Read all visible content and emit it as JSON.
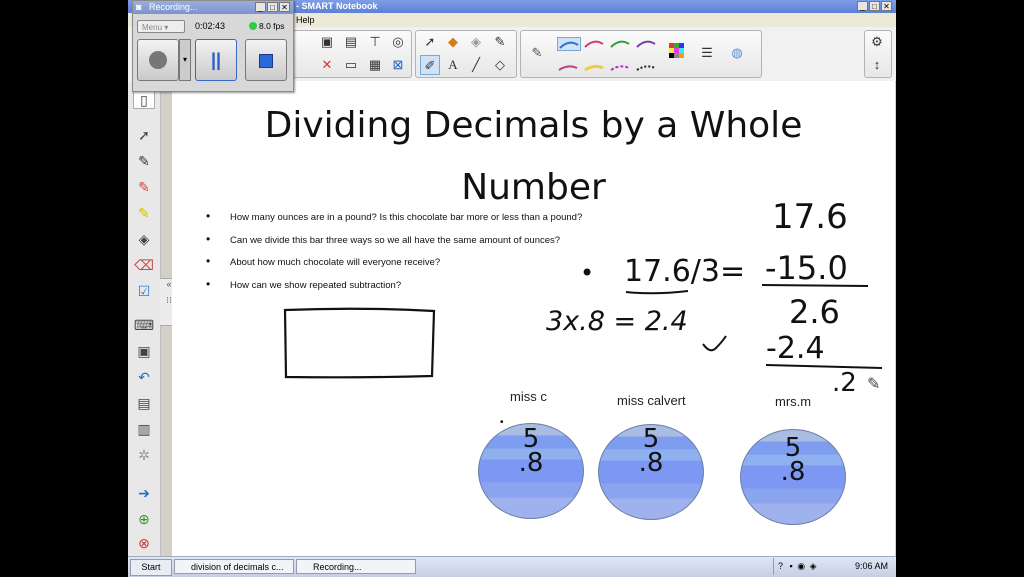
{
  "window": {
    "title": "- SMART Notebook",
    "menu_visible": "Help",
    "buttons": [
      "_",
      "□",
      "✕"
    ]
  },
  "recorder": {
    "title": "Recording...",
    "menu_label": "Menu",
    "time": "0:02:43",
    "fps": "8.0 fps",
    "fps_status_color": "#2ecc40"
  },
  "slide": {
    "heading_line1": "Dividing Decimals by a Whole",
    "heading_line2": "Number",
    "bullets": [
      "How many ounces are in a pound?  Is this chocolate bar more or less than a pound?",
      "Can we divide this bar three ways so we all have the same amount of ounces?",
      "About how much chocolate will everyone receive?",
      "How can we show repeated subtraction?"
    ],
    "handwriting": {
      "bullet": "•",
      "equation": "17.6/3=",
      "multiply": "3x.8 = 2.4",
      "division": [
        "17.6",
        "-15.0",
        "2.6",
        "-2.4",
        ".2"
      ]
    },
    "names": [
      "miss c",
      "miss calvert",
      "mrs.m"
    ],
    "circle_digits": [
      [
        "5",
        ".8"
      ],
      [
        "5",
        ".8"
      ],
      [
        "5",
        ".8"
      ]
    ]
  },
  "taskbar": {
    "start": "Start",
    "tasks": [
      "division of decimals c...",
      "Recording..."
    ],
    "clock": "9:06 AM"
  }
}
